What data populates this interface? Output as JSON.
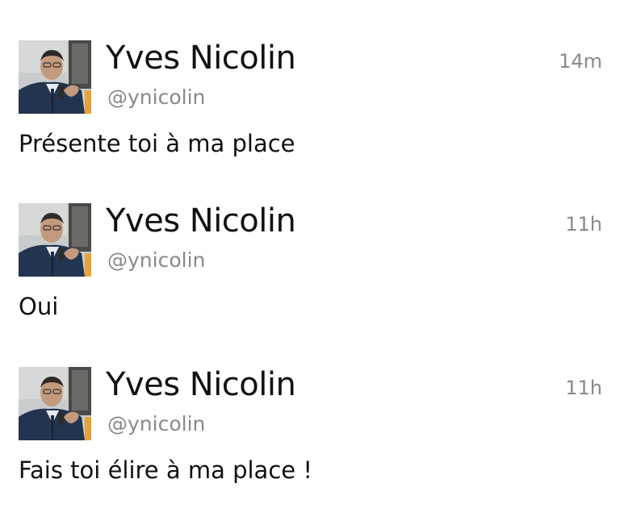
{
  "tweets": [
    {
      "author": "Yves Nicolin",
      "handle": "@ynicolin",
      "time": "14m",
      "text": "Présente toi à ma place"
    },
    {
      "author": "Yves Nicolin",
      "handle": "@ynicolin",
      "time": "11h",
      "text": "Oui"
    },
    {
      "author": "Yves Nicolin",
      "handle": "@ynicolin",
      "time": "11h",
      "text": "Fais toi élire à ma place !"
    }
  ],
  "colors": {
    "text": "#111111",
    "secondary": "#8a8a8a",
    "background": "#ffffff"
  }
}
